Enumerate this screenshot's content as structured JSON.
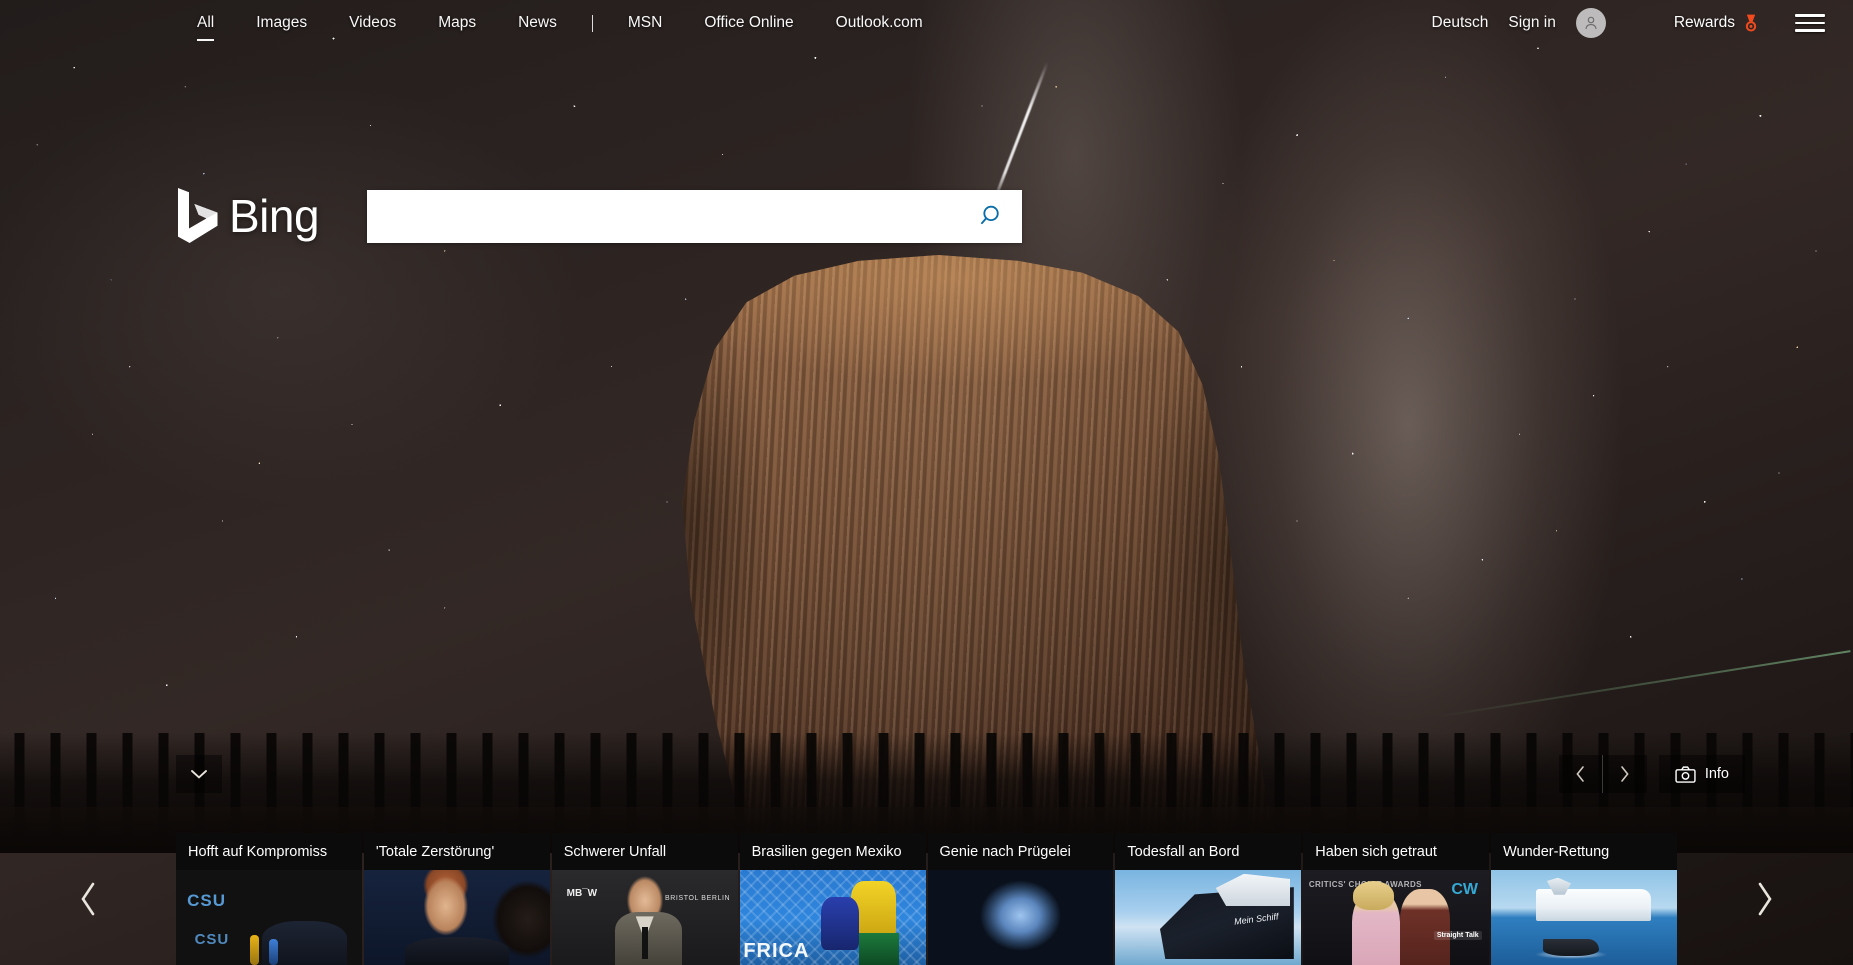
{
  "nav": {
    "left_items": [
      {
        "label": "All",
        "active": true
      },
      {
        "label": "Images",
        "active": false
      },
      {
        "label": "Videos",
        "active": false
      },
      {
        "label": "Maps",
        "active": false
      },
      {
        "label": "News",
        "active": false
      }
    ],
    "right_of_separator": [
      {
        "label": "MSN"
      },
      {
        "label": "Office Online"
      },
      {
        "label": "Outlook.com"
      }
    ],
    "language": "Deutsch",
    "sign_in": "Sign in",
    "rewards": "Rewards",
    "rewards_icon": "medal-icon",
    "rewards_color": "#f04a1e",
    "avatar_icon": "person-icon",
    "menu_icon": "hamburger-icon"
  },
  "brand": {
    "logo_text": "Bing",
    "logo_icon": "bing-b-logo"
  },
  "search": {
    "value": "",
    "placeholder": "",
    "button_icon": "search-icon",
    "button_color": "#0a6ca8"
  },
  "image_controls": {
    "collapse_icon": "chevron-down-icon",
    "prev_icon": "chevron-left-icon",
    "next_icon": "chevron-right-icon",
    "info_icon": "camera-icon",
    "info_label": "Info"
  },
  "carousel": {
    "prev_icon": "chevron-left-icon",
    "next_icon": "chevron-right-icon",
    "cards": [
      {
        "title": "Hofft auf Kompromiss",
        "art": "th-csu"
      },
      {
        "title": "'Totale Zerstörung'",
        "art": "th-portrait"
      },
      {
        "title": "Schwerer Unfall",
        "art": "th-mbfw"
      },
      {
        "title": "Brasilien gegen Mexiko",
        "art": "th-soccer"
      },
      {
        "title": "Genie nach Prügelei",
        "art": "th-brain"
      },
      {
        "title": "Todesfall an Bord",
        "art": "th-ship"
      },
      {
        "title": "Haben sich getraut",
        "art": "th-redcarpet"
      },
      {
        "title": "Wunder-Rettung",
        "art": "th-rescue"
      }
    ]
  },
  "thumb_text": {
    "csu_1": "CSU",
    "mbfw": "MB FW",
    "mbfw_brand": "BRISTOL BERLIN",
    "soccer": "FRICA",
    "ship_name": "Mein Schiff",
    "critics": "CRITICS' CHOICE AWARDS",
    "cw": "CW",
    "straight_talk": "Straight Talk"
  }
}
